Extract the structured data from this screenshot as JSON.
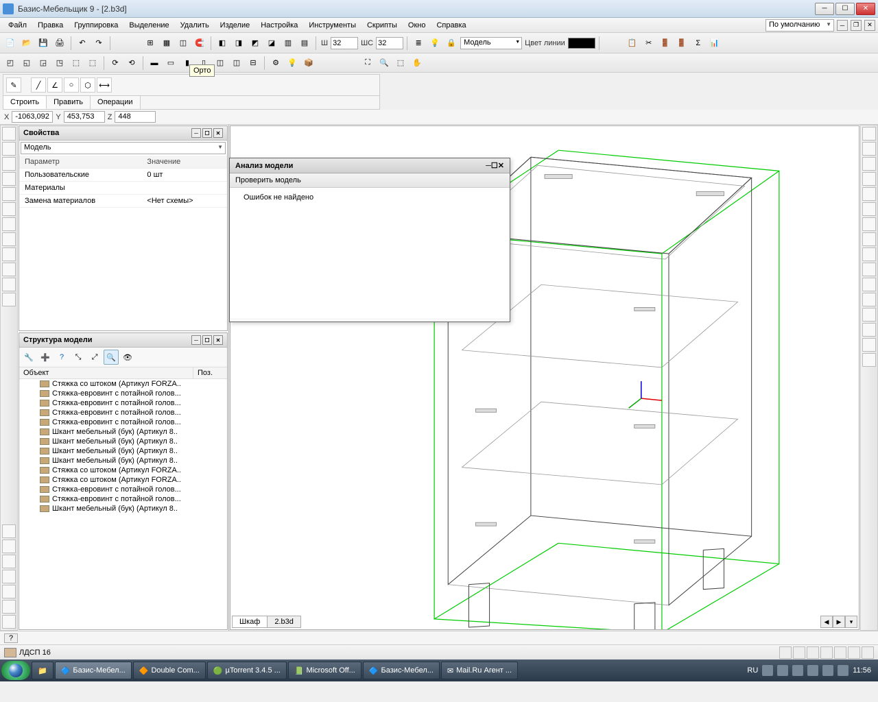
{
  "window": {
    "title": "Базис-Мебельщик 9 - [2.b3d]"
  },
  "menu": [
    "Файл",
    "Правка",
    "Группировка",
    "Выделение",
    "Удалить",
    "Изделие",
    "Настройка",
    "Инструменты",
    "Скрипты",
    "Окно",
    "Справка"
  ],
  "default_dropdown": "По умолчанию",
  "tooltip_ortho": "Орто",
  "toolbar": {
    "w_label": "Ш",
    "w_value": "32",
    "wc_label": "ШС",
    "wc_value": "32",
    "mode": "Модель",
    "linecolor_label": "Цвет линии"
  },
  "draw_tabs": [
    "Строить",
    "Править",
    "Операции"
  ],
  "coords": {
    "x_label": "X",
    "x": "-1063,092",
    "y_label": "Y",
    "y": "453,753",
    "z_label": "Z",
    "z": "448"
  },
  "properties": {
    "title": "Свойства",
    "selector": "Модель",
    "cols": [
      "Параметр",
      "Значение"
    ],
    "rows": [
      [
        "Пользовательские",
        "0 шт"
      ],
      [
        "Материалы",
        ""
      ],
      [
        "Замена материалов",
        "<Нет схемы>"
      ]
    ]
  },
  "structure": {
    "title": "Структура модели",
    "cols": [
      "Объект",
      "Поз."
    ],
    "items": [
      "Стяжка со штоком (Артикул FORZA..",
      "Стяжка-евровинт с потайной голов...",
      "Стяжка-евровинт с потайной голов...",
      "Стяжка-евровинт с потайной голов...",
      "Стяжка-евровинт с потайной голов...",
      "Шкант мебельный (бук) (Артикул 8..",
      "Шкант мебельный (бук) (Артикул 8..",
      "Шкант мебельный (бук) (Артикул 8..",
      "Шкант мебельный (бук) (Артикул 8..",
      "Стяжка со штоком (Артикул FORZA..",
      "Стяжка со штоком (Артикул FORZA..",
      "Стяжка-евровинт с потайной голов...",
      "Стяжка-евровинт с потайной голов...",
      "Шкант мебельный (бук) (Артикул 8.."
    ]
  },
  "analysis": {
    "title": "Анализ модели",
    "button": "Проверить модель",
    "result": "Ошибок не найдено"
  },
  "viewport_tabs": [
    "Шкаф",
    "2.b3d"
  ],
  "status": {
    "material": "ЛДСП 16",
    "help": "?"
  },
  "taskbar": {
    "items": [
      "Базис-Мебел...",
      "Double Com...",
      "µTorrent 3.4.5 ...",
      "Microsoft Off...",
      "Базис-Мебел...",
      "Mail.Ru Агент ..."
    ],
    "lang": "RU",
    "time": "11:56"
  }
}
